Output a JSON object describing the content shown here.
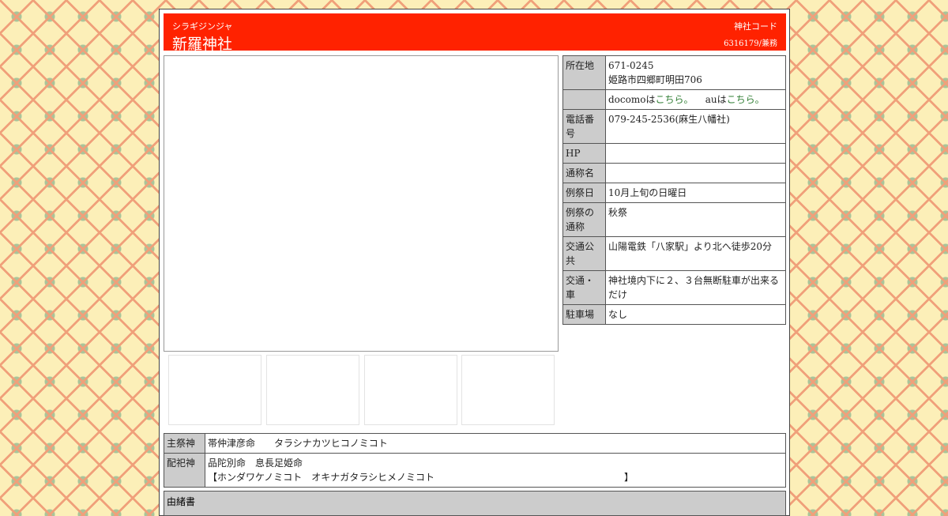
{
  "header": {
    "kana": "シラギジンジャ",
    "title": "新羅神社",
    "code_label": "神社コード",
    "code_value": "6316179/兼務"
  },
  "info": {
    "address_label": "所在地",
    "postal": "671-0245",
    "address": "姫路市四郷町明田706",
    "mobile_docomo": "docomoは",
    "mobile_docomo_link": "こちら。",
    "mobile_au": "auは",
    "mobile_au_link": "こちら。",
    "phone_label": "電話番号",
    "phone": "079-245-2536(麻生八幡社)",
    "hp_label": "HP",
    "hp": "",
    "alias_label": "通称名",
    "alias": "",
    "festival_label": "例祭日",
    "festival": "10月上旬の日曜日",
    "festival_alias_label": "例祭の通称",
    "festival_alias": "秋祭",
    "transit_label": "交通公共",
    "transit": "山陽電鉄「八家駅」より北へ徒歩20分",
    "car_label": "交通・車",
    "car": "神社境内下に２、３台無断駐車が出来るだけ",
    "parking_label": "駐車場",
    "parking": "なし"
  },
  "deities": {
    "main_label": "主祭神",
    "main": "帯仲津彦命　　タラシナカツヒコノミコト",
    "enshrined_label": "配祀神",
    "enshrined_line1": "品陀別命　息長足姫命",
    "enshrined_line2": "【ホンダワケノミコト　オキナガタラシヒメノミコト　　　　　　　　　　　　　　　　　　　　】"
  },
  "bottom": {
    "label": "由緒書"
  }
}
